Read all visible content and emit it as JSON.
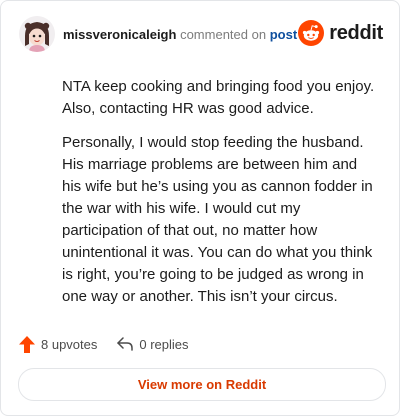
{
  "comment": {
    "author": "missveronicaleigh",
    "action_text": "commented on",
    "post_link": "post",
    "paragraphs": [
      "NTA keep cooking and bringing food you enjoy. Also, contacting HR was good advice.",
      "Personally, I would stop feeding the husband. His marriage problems are between him and his wife but he’s using you as cannon fodder in the war with his wife. I would cut my participation of that out, no matter how unintentional it was. You can do what you think is right, you’re going to be judged as wrong in one way or another. This isn’t your circus."
    ]
  },
  "brand": {
    "wordmark": "reddit",
    "icon": "reddit-snoo-icon",
    "color": "#ff4500"
  },
  "stats": {
    "upvotes_label": "8 upvotes",
    "replies_label": "0 replies",
    "upvote_icon": "upvote-arrow-icon",
    "reply_icon": "reply-arrow-icon",
    "upvote_color": "#ff4500"
  },
  "footer": {
    "view_more_label": "View more on Reddit",
    "accent": "#d93a00"
  }
}
